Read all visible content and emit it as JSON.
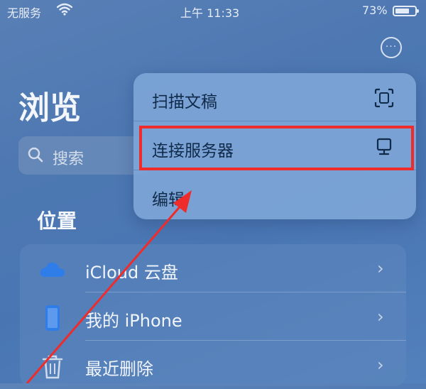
{
  "status_bar": {
    "carrier": "无服务",
    "time": "上午 11:33",
    "battery_percent_text": "73%",
    "battery_level": 0.73
  },
  "header": {
    "title": "浏览",
    "more_label": "···"
  },
  "search": {
    "placeholder": "搜索"
  },
  "locations": {
    "section_title": "位置",
    "items": [
      {
        "label": "iCloud 云盘",
        "icon": "cloud-icon"
      },
      {
        "label": "我的 iPhone",
        "icon": "iphone-icon"
      },
      {
        "label": "最近删除",
        "icon": "trash-icon"
      }
    ]
  },
  "menu": {
    "items": [
      {
        "label": "扫描文稿",
        "icon": "scan-document-icon"
      },
      {
        "label": "连接服务器",
        "icon": "server-icon",
        "highlighted": true
      },
      {
        "label": "编辑"
      }
    ]
  },
  "colors": {
    "highlight_border": "#ee2c2c",
    "annotation_arrow": "#ee2c2c"
  }
}
